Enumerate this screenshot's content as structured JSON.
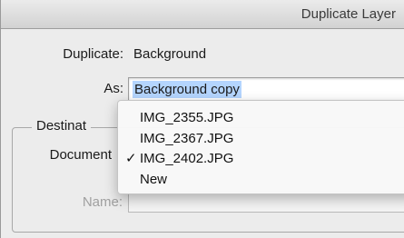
{
  "window": {
    "title": "Duplicate Layer"
  },
  "duplicate": {
    "label": "Duplicate:",
    "value": "Background"
  },
  "as": {
    "label": "As:",
    "value": "Background copy"
  },
  "destination": {
    "legend": "Destinat",
    "document_label": "Document",
    "name_label": "Name:",
    "name_value": ""
  },
  "document_menu": {
    "items": [
      {
        "label": "IMG_2355.JPG",
        "checked": false
      },
      {
        "label": "IMG_2367.JPG",
        "checked": false
      },
      {
        "label": "IMG_2402.JPG",
        "checked": true
      },
      {
        "label": "New",
        "checked": false
      }
    ],
    "check_glyph": "✓"
  }
}
